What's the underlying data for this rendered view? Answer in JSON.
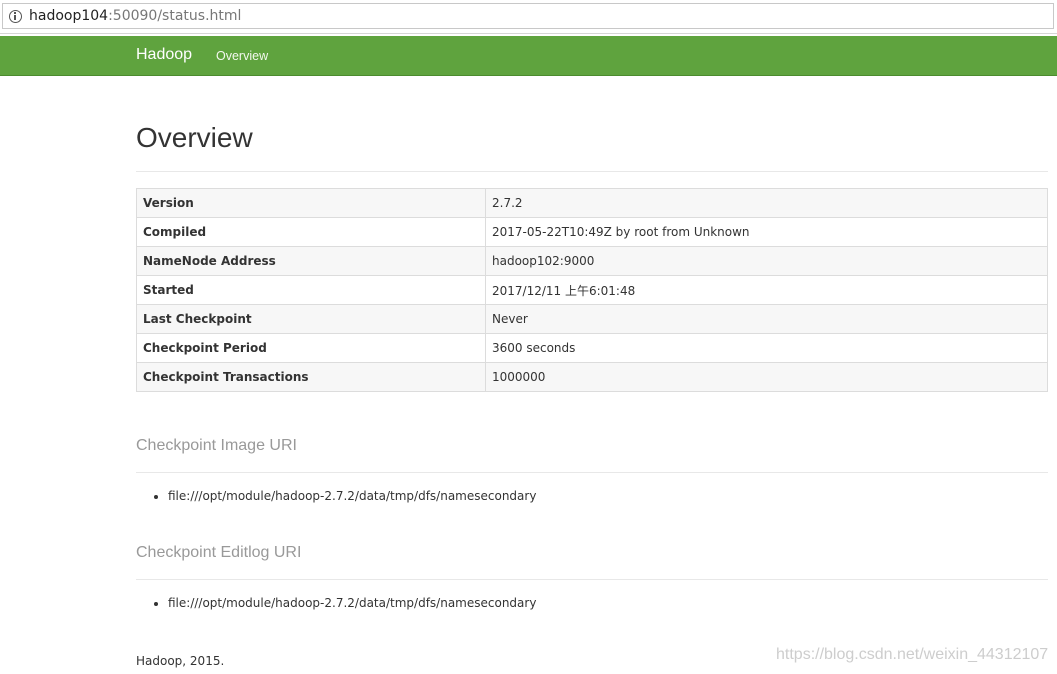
{
  "address_bar": {
    "host": "hadoop104",
    "rest": ":50090/status.html"
  },
  "navbar": {
    "brand": "Hadoop",
    "overview": "Overview",
    "color": "#5fa33e"
  },
  "main": {
    "title": "Overview",
    "table": [
      {
        "key": "Version",
        "value": "2.7.2"
      },
      {
        "key": "Compiled",
        "value": "2017-05-22T10:49Z by root from Unknown"
      },
      {
        "key": "NameNode Address",
        "value": "hadoop102:9000"
      },
      {
        "key": "Started",
        "value": "2017/12/11 上午6:01:48"
      },
      {
        "key": "Last Checkpoint",
        "value": "Never"
      },
      {
        "key": "Checkpoint Period",
        "value": "3600 seconds"
      },
      {
        "key": "Checkpoint Transactions",
        "value": "1000000"
      }
    ],
    "image_uri": {
      "title": "Checkpoint Image URI",
      "items": [
        "file:///opt/module/hadoop-2.7.2/data/tmp/dfs/namesecondary"
      ]
    },
    "editlog_uri": {
      "title": "Checkpoint Editlog URI",
      "items": [
        "file:///opt/module/hadoop-2.7.2/data/tmp/dfs/namesecondary"
      ]
    }
  },
  "footer": {
    "text": "Hadoop, 2015."
  },
  "watermark": "https://blog.csdn.net/weixin_44312107"
}
